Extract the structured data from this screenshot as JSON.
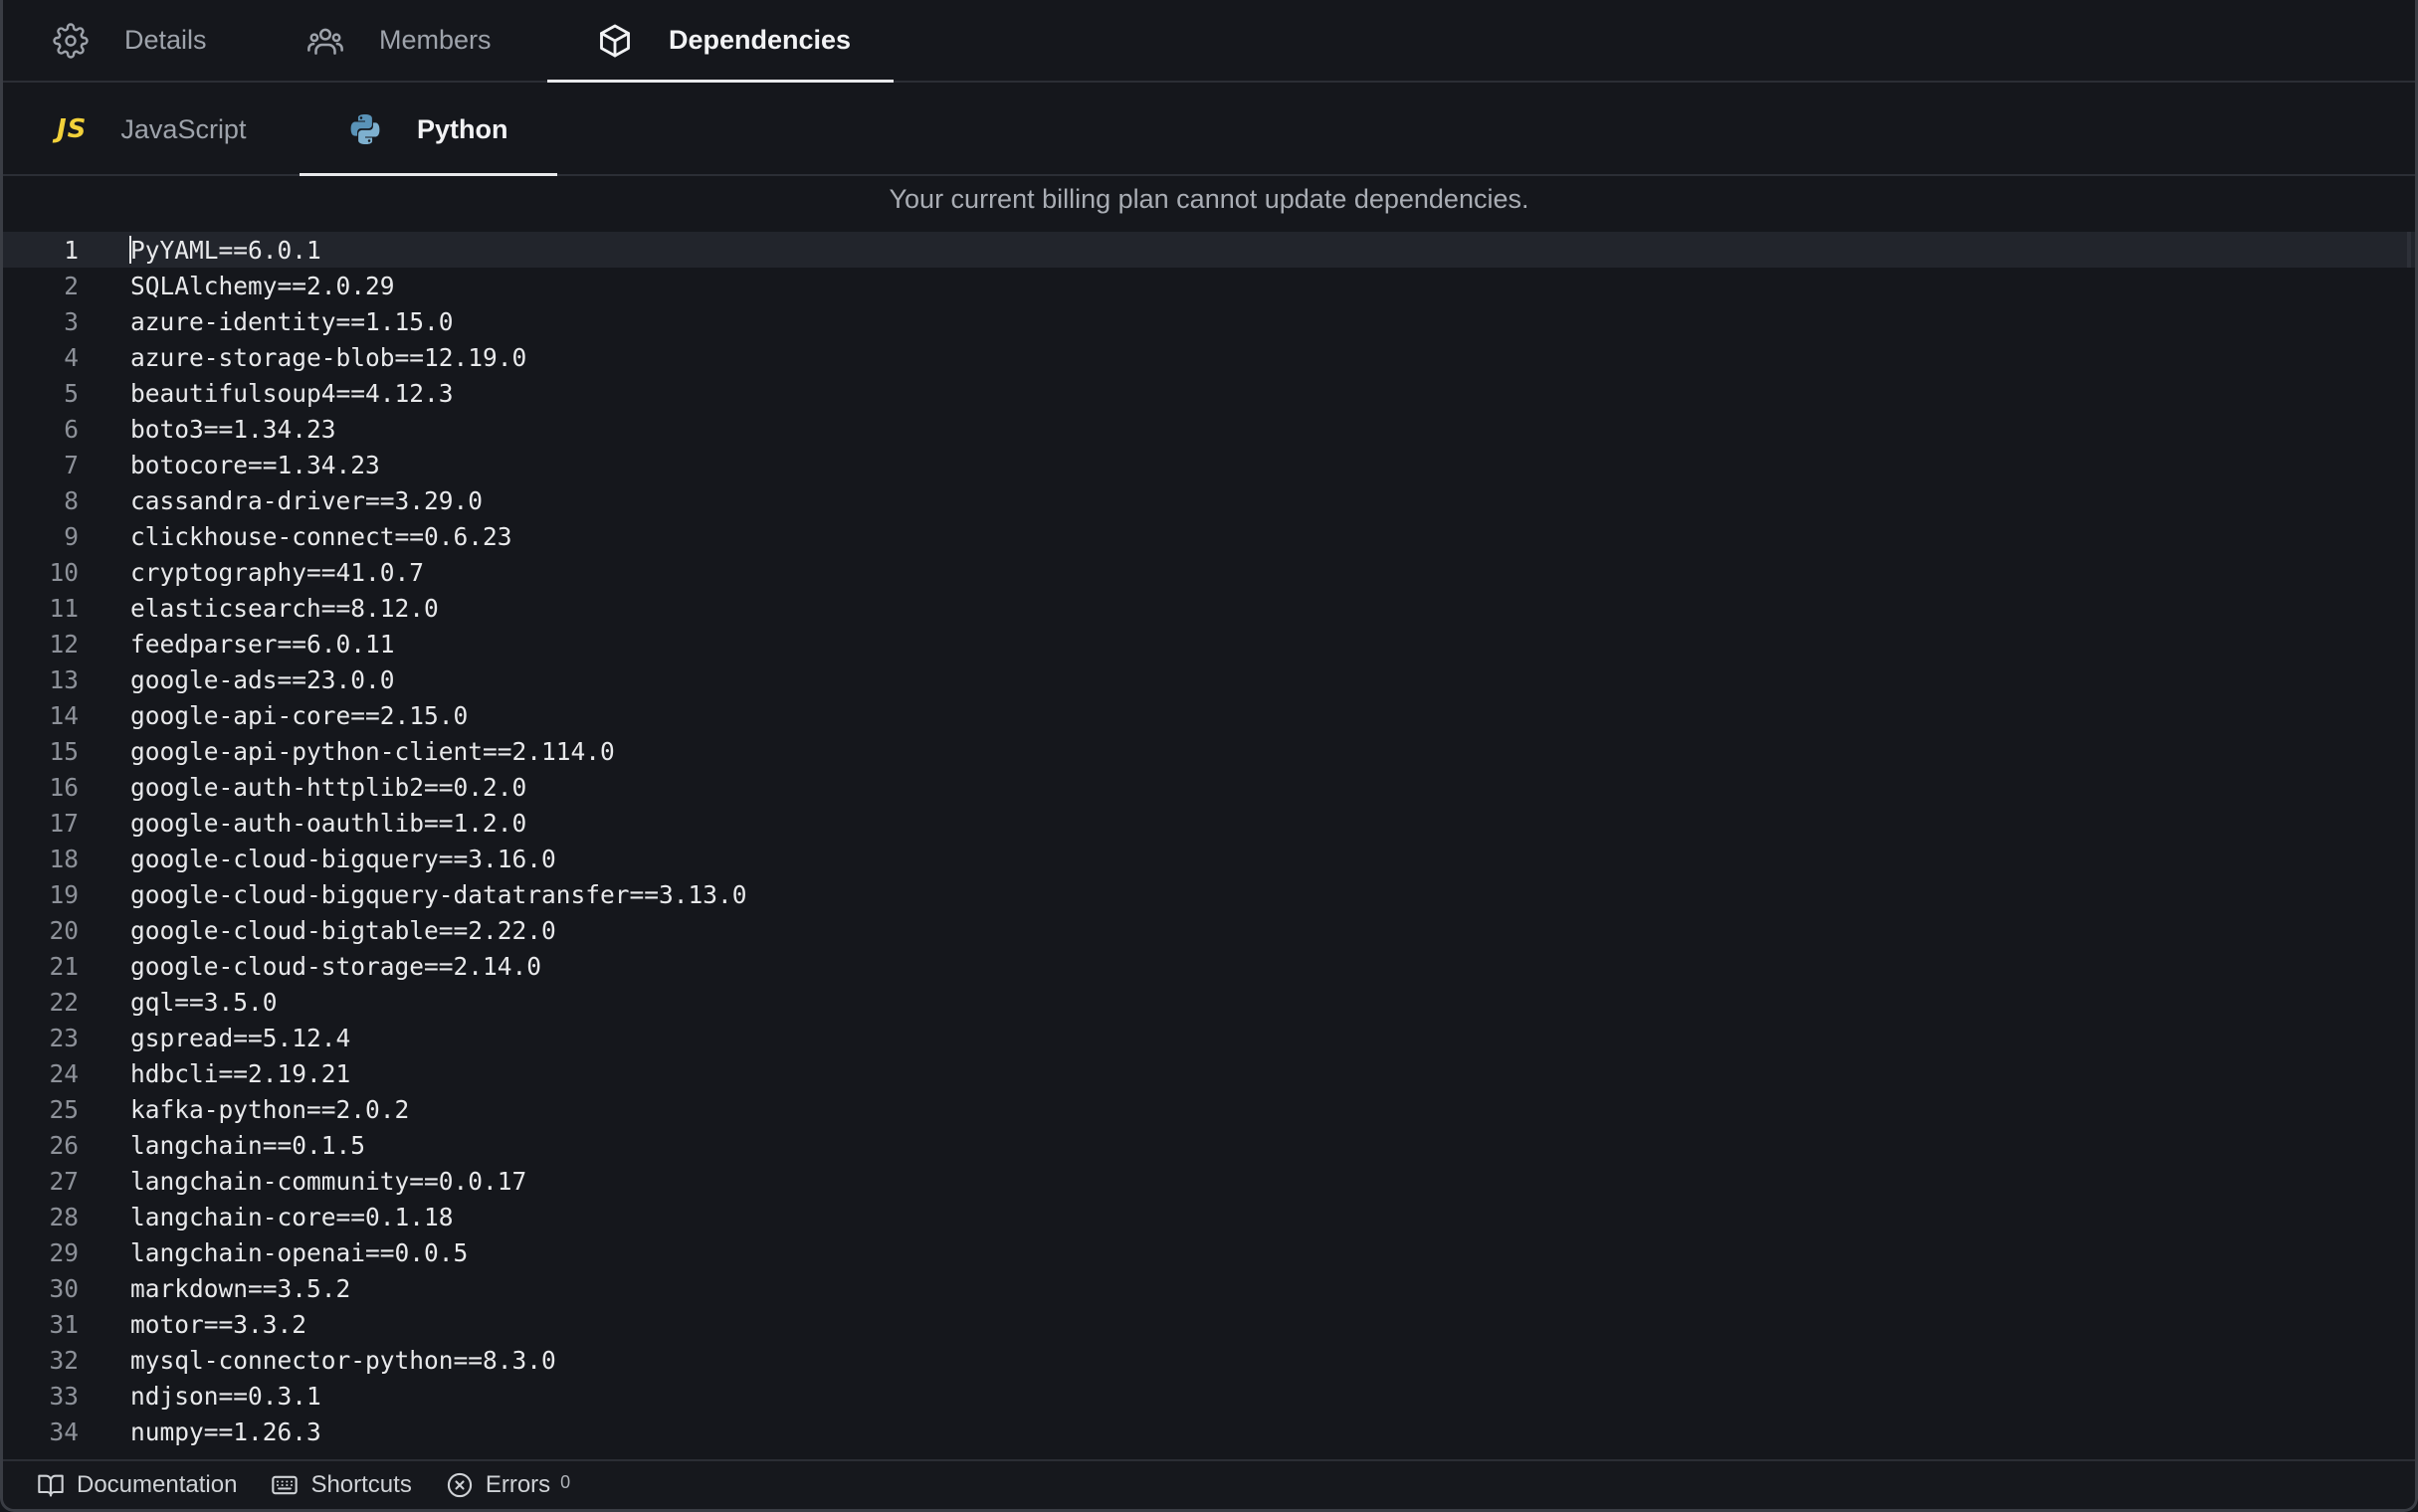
{
  "tabs": {
    "details": "Details",
    "members": "Members",
    "dependencies": "Dependencies"
  },
  "subtabs": {
    "javascript": "JavaScript",
    "js_badge": "JS",
    "python": "Python"
  },
  "notice": "Your current billing plan cannot update dependencies.",
  "editor": {
    "lines": [
      "PyYAML==6.0.1",
      "SQLAlchemy==2.0.29",
      "azure-identity==1.15.0",
      "azure-storage-blob==12.19.0",
      "beautifulsoup4==4.12.3",
      "boto3==1.34.23",
      "botocore==1.34.23",
      "cassandra-driver==3.29.0",
      "clickhouse-connect==0.6.23",
      "cryptography==41.0.7",
      "elasticsearch==8.12.0",
      "feedparser==6.0.11",
      "google-ads==23.0.0",
      "google-api-core==2.15.0",
      "google-api-python-client==2.114.0",
      "google-auth-httplib2==0.2.0",
      "google-auth-oauthlib==1.2.0",
      "google-cloud-bigquery==3.16.0",
      "google-cloud-bigquery-datatransfer==3.13.0",
      "google-cloud-bigtable==2.22.0",
      "google-cloud-storage==2.14.0",
      "gql==3.5.0",
      "gspread==5.12.4",
      "hdbcli==2.19.21",
      "kafka-python==2.0.2",
      "langchain==0.1.5",
      "langchain-community==0.0.17",
      "langchain-core==0.1.18",
      "langchain-openai==0.0.5",
      "markdown==3.5.2",
      "motor==3.3.2",
      "mysql-connector-python==8.3.0",
      "ndjson==0.3.1",
      "numpy==1.26.3"
    ]
  },
  "status": {
    "documentation": "Documentation",
    "shortcuts": "Shortcuts",
    "errors": "Errors",
    "error_count": "0"
  }
}
